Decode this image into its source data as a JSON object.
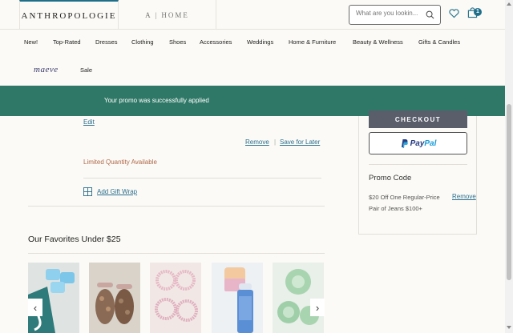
{
  "header": {
    "brand": "ANTHROPOLOGIE",
    "home_tab": "A | HOME",
    "search_placeholder": "What are you lookin...",
    "cart_count": "1"
  },
  "nav": {
    "items": [
      "New!",
      "Top-Rated",
      "Dresses",
      "Clothing",
      "Shoes",
      "Accessories",
      "Weddings",
      "Home & Furniture",
      "Beauty & Wellness",
      "Gifts & Candles"
    ],
    "sub_items": [
      "maeve",
      "Sale"
    ]
  },
  "promo_bar": {
    "message": "Your promo was successfully applied"
  },
  "cart": {
    "edit": "Edit",
    "remove": "Remove",
    "separator": "|",
    "save_later": "Save for Later",
    "limited": "Limited Quantity Available",
    "gift_wrap": "Add Gift Wrap"
  },
  "summary": {
    "checkout": "CHECKOUT",
    "paypal_pay": "Pay",
    "paypal_pal": "Pal",
    "promo_title": "Promo Code",
    "promo_desc": "$20 Off One Regular-Price Pair of Jeans $100+",
    "promo_remove": "Remove"
  },
  "favorites": {
    "title": "Our Favorites Under $25",
    "prev_arrow": "‹",
    "next_arrow": "›"
  },
  "colors": {
    "promo_bar": "#2f7867",
    "link": "#2b6f8e",
    "checkout_bg": "#5a5e6b",
    "limited": "#b06a4a"
  }
}
